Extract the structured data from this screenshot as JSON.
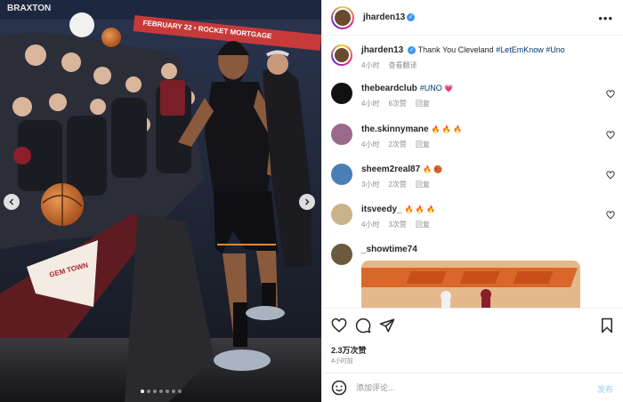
{
  "post": {
    "username": "jharden13",
    "caption": "Thank You Cleveland ",
    "tags": [
      "#LetEmKnow",
      "#Uno"
    ],
    "time": "4小时",
    "translate_label": "查看翻译",
    "likes": "2.3万次赞",
    "timestamp": "4小时前",
    "background_text": {
      "arena_sign": "BRAXTON",
      "banner": "FEBRUARY 22 • ROCKET MORTGAGE",
      "towel_text": "GEM TOWN"
    }
  },
  "comments": [
    {
      "username": "thebeardclub",
      "text_prefix": "",
      "tag": "#UNO",
      "emoji": "💗",
      "time": "4小时",
      "likes": "6次赞",
      "reply": "回复",
      "avatar_color": "#111111"
    },
    {
      "username": "the.skinnymane",
      "text_prefix": "",
      "tag": "",
      "emoji": "🔥 🔥 🔥",
      "time": "4小时",
      "likes": "2次赞",
      "reply": "回复",
      "avatar_color": "#9a6a8a"
    },
    {
      "username": "sheem2real87",
      "text_prefix": "",
      "tag": "",
      "emoji": "🔥 🏀",
      "time": "3小时",
      "likes": "2次赞",
      "reply": "回复",
      "avatar_color": "#4a7fb5"
    },
    {
      "username": "itsveedy_",
      "text_prefix": "",
      "tag": "",
      "emoji": "🔥 🔥 🔥",
      "time": "4小时",
      "likes": "3次赞",
      "reply": "回复",
      "avatar_color": "#c9b48a"
    },
    {
      "username": "_showtime74",
      "text_prefix": "",
      "tag": "",
      "emoji": "",
      "time": "",
      "likes": "",
      "reply": "",
      "avatar_color": "#6b5a3e"
    }
  ],
  "composer": {
    "placeholder": "添加评论...",
    "post_label": "发布"
  },
  "icons": [
    "more-icon",
    "heart-icon",
    "comment-icon",
    "share-icon",
    "bookmark-icon",
    "emoji-icon",
    "verified-icon",
    "chevron-left-icon",
    "chevron-right-icon"
  ],
  "carousel": {
    "count": 7,
    "active": 1
  },
  "colors": {
    "link": "#00376b",
    "verified": "#3897f0",
    "post_button": "#b2dffc",
    "like_red": "#ed4956"
  }
}
